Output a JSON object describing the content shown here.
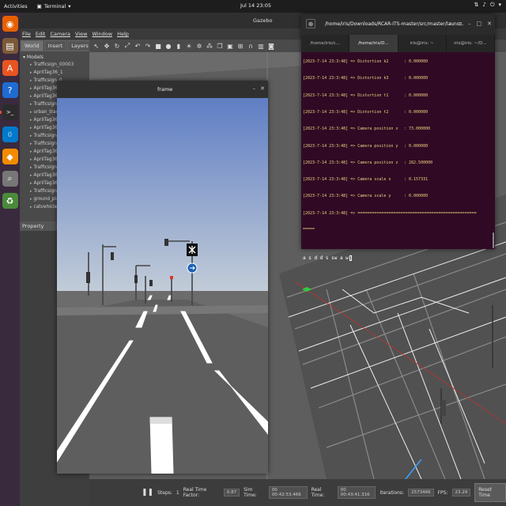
{
  "topbar": {
    "activities": "Activities",
    "app": "Terminal",
    "clock": "Jul 14  23:05"
  },
  "dock": {
    "items": [
      {
        "name": "firefox-icon",
        "color": "#e66000",
        "glyph": "◉"
      },
      {
        "name": "files-icon",
        "color": "#7a5a3a",
        "glyph": "▤"
      },
      {
        "name": "software-icon",
        "color": "#e95420",
        "glyph": "A"
      },
      {
        "name": "help-icon",
        "color": "#1e6cd2",
        "glyph": "?"
      },
      {
        "name": "terminal-icon",
        "color": "#2c2c2c",
        "glyph": ">_"
      },
      {
        "name": "vscode-icon",
        "color": "#007acc",
        "glyph": "⟨⟩"
      },
      {
        "name": "layers-icon",
        "color": "#f28b00",
        "glyph": "◆"
      },
      {
        "name": "magnifier-icon",
        "color": "#777777",
        "glyph": "⌕"
      },
      {
        "name": "trash-icon",
        "color": "#4a8a3a",
        "glyph": "♻"
      }
    ]
  },
  "gazebo": {
    "title": "Gazebo",
    "menu": [
      "File",
      "Edit",
      "Camera",
      "View",
      "Window",
      "Help"
    ],
    "tabs": [
      "World",
      "Insert",
      "Layers"
    ],
    "tree_root": "Models",
    "models": [
      "Trafficsign_00003",
      "AprilTag36_1",
      "Trafficsign_0",
      "AprilTag36_1",
      "AprilTag36_1",
      "Trafficsign_0",
      "urban_track",
      "AprilTag36_1",
      "AprilTag36_1",
      "Trafficsign_0",
      "Trafficsign_0",
      "AprilTag36_1",
      "AprilTag36_1",
      "Trafficsign_0",
      "AprilTag36_1",
      "AprilTag36_1",
      "Trafficsign_0",
      "ground_plan"
    ],
    "selected_model": "catvehicle",
    "property_header": "Property",
    "value_header": "V",
    "bottom": {
      "steps_label": "Steps:",
      "steps_value": "1",
      "rtf_label": "Real Time Factor:",
      "rtf_value": "0.87",
      "sim_time_label": "Sim Time:",
      "sim_time_value": "00 00:42:53.466",
      "real_time_label": "Real Time:",
      "real_time_value": "00 00:43:41.316",
      "iterations_label": "Iterations:",
      "iterations_value": "2573466",
      "fps_label": "FPS:",
      "fps_value": "23.29",
      "reset_label": "Reset Time"
    }
  },
  "frame_window": {
    "title": "frame"
  },
  "terminal": {
    "title": "/home/iris/Downloads/RCAR-ITS-master/src/master/launc...",
    "tabs": [
      "/home/iris/c...",
      "/home/iris/D...",
      "iris@iris: ~",
      "iris@iris: ~/D..."
    ],
    "active_tab": 1,
    "lines": [
      {
        "prefix": "[2023-7-14 23:3:48] => Distortion k2",
        "value": ": 0.000000"
      },
      {
        "prefix": "[2023-7-14 23:3:48] => Distortion k3",
        "value": ": 0.000000"
      },
      {
        "prefix": "[2023-7-14 23:3:48] => Distortion t1",
        "value": ": 0.000000"
      },
      {
        "prefix": "[2023-7-14 23:3:48] => Distortion t2",
        "value": ": 0.000000"
      },
      {
        "prefix": "[2023-7-14 23:3:48] => Camera position x",
        "value": ": 73.000000"
      },
      {
        "prefix": "[2023-7-14 23:3:48] => Camera position y",
        "value": ": 0.000000"
      },
      {
        "prefix": "[2023-7-14 23:3:48] => Camera position z",
        "value": ": 282.500000"
      },
      {
        "prefix": "[2023-7-14 23:3:48] => Camera scale x",
        "value": ": 0.157331"
      },
      {
        "prefix": "[2023-7-14 23:3:48] => Camera scale y",
        "value": ": 0.000000"
      },
      {
        "prefix": "[2023-7-14 23:3:48] => ==================================================",
        "value": ""
      }
    ],
    "separator_tail": "=====",
    "input": "a s d d s sw a w"
  }
}
